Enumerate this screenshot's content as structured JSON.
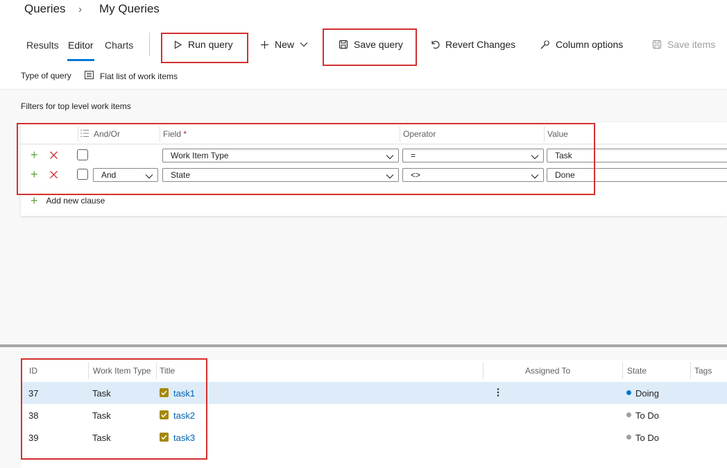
{
  "breadcrumb": {
    "root": "Queries",
    "separator": "›",
    "current": "My Queries"
  },
  "tabs": [
    {
      "label": "Results"
    },
    {
      "label": "Editor",
      "active": true
    },
    {
      "label": "Charts"
    }
  ],
  "toolbar": {
    "run_query": "Run query",
    "new": "New",
    "save_query": "Save query",
    "revert": "Revert Changes",
    "column_options": "Column options",
    "save_items": "Save items"
  },
  "query_type": {
    "label": "Type of query",
    "value": "Flat list of work items"
  },
  "filters": {
    "heading": "Filters for top level work items",
    "columns": {
      "andor": "And/Or",
      "field": "Field",
      "required_mark": "*",
      "operator": "Operator",
      "value": "Value"
    },
    "clauses": [
      {
        "andor": "",
        "field": "Work Item Type",
        "operator": "=",
        "value": "Task"
      },
      {
        "andor": "And",
        "field": "State",
        "operator": "<>",
        "value": "Done"
      }
    ],
    "add_clause": "Add new clause"
  },
  "results": {
    "columns": {
      "id": "ID",
      "type": "Work Item Type",
      "title": "Title",
      "assigned": "Assigned To",
      "state": "State",
      "tags": "Tags"
    },
    "rows": [
      {
        "id": "37",
        "type": "Task",
        "title": "task1",
        "state": "Doing",
        "state_color": "#0078d4",
        "selected": true
      },
      {
        "id": "38",
        "type": "Task",
        "title": "task2",
        "state": "To Do",
        "state_color": "#a19f9d"
      },
      {
        "id": "39",
        "type": "Task",
        "title": "task3",
        "state": "To Do",
        "state_color": "#a19f9d"
      }
    ]
  },
  "colors": {
    "accent": "#0078d4",
    "highlight": "#d32f2f",
    "add_green": "#61a33a",
    "delete_red": "#d13438",
    "task_gold": "#a4880a"
  }
}
